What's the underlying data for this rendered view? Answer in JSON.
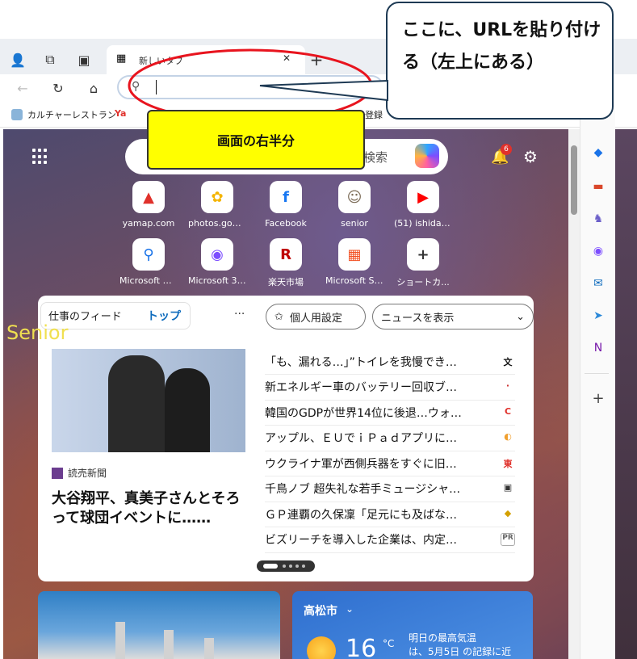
{
  "browser": {
    "tab_title": "新しいタブ",
    "tab_close": "✕",
    "new_tab": "+",
    "favorites": [
      {
        "label": "カルチャーレストラン"
      },
      {
        "label": "Ya"
      },
      {
        "label": "登録"
      }
    ]
  },
  "newtab": {
    "search_placeholder": "検索",
    "notification_count": "6",
    "tiles_row1": [
      {
        "label": "yamap.com",
        "glyph": "▲",
        "color": "#e0312b"
      },
      {
        "label": "photos.goog...",
        "glyph": "✿",
        "color": "#f4b400"
      },
      {
        "label": "Facebook",
        "glyph": "f",
        "color": "#1877f2"
      },
      {
        "label": "senior",
        "glyph": "☺",
        "color": "#7a6a55"
      },
      {
        "label": "(51) ishidan1...",
        "glyph": "▶",
        "color": "#ff0000"
      }
    ],
    "tiles_row2": [
      {
        "label": "Microsoft D...",
        "glyph": "⚲",
        "color": "#1a73e8"
      },
      {
        "label": "Microsoft 365",
        "glyph": "◉",
        "color": "#7c4dff"
      },
      {
        "label": "楽天市場",
        "glyph": "R",
        "color": "#bf0000"
      },
      {
        "label": "Microsoft St...",
        "glyph": "▦",
        "color": "#f25022"
      },
      {
        "label": "ショートカ...",
        "glyph": "+",
        "color": "#333333"
      }
    ]
  },
  "feed": {
    "tab_work": "仕事のフィード",
    "tab_top": "トップ",
    "more": "···",
    "personalize": "個人用設定",
    "show_news": "ニュースを表示",
    "watermark": "Senior",
    "publisher": "読売新聞",
    "headline": "大谷翔平、真美子さんとそろって球団イベントに……",
    "items": [
      {
        "text": "「も、漏れる…」”トイレを我慢でき…",
        "src": "文"
      },
      {
        "text": "新エネルギー車のバッテリー回収ブ…",
        "src": "·"
      },
      {
        "text": "韓国のGDPが世界14位に後退…ウォ…",
        "src": "C"
      },
      {
        "text": "アップル、ＥＵでｉＰａｄアプリに…",
        "src": "◐"
      },
      {
        "text": "ウクライナ軍が西側兵器をすぐに旧…",
        "src": "東"
      },
      {
        "text": "千鳥ノブ 超失礼な若手ミュージシャ…",
        "src": "▣"
      },
      {
        "text": "ＧＰ連覇の久保凜「足元にも及ばな…",
        "src": "◆"
      },
      {
        "text": "ビズリーチを導入した企業は、内定…",
        "src": "PR"
      }
    ]
  },
  "weather": {
    "city": "高松市",
    "temp": "16",
    "unit": "°C",
    "note_line1": "明日の最高気温",
    "note_line2": "は、5月5日 の記録に近"
  },
  "annotations": {
    "bubble_text": "ここに、URLを貼り付ける（左上にある）",
    "yellow_label": "画面の右半分"
  },
  "colors": {
    "annotation_red": "#e8141e",
    "bubble_border": "#1e3a54",
    "highlight_yellow": "#ffff00"
  }
}
